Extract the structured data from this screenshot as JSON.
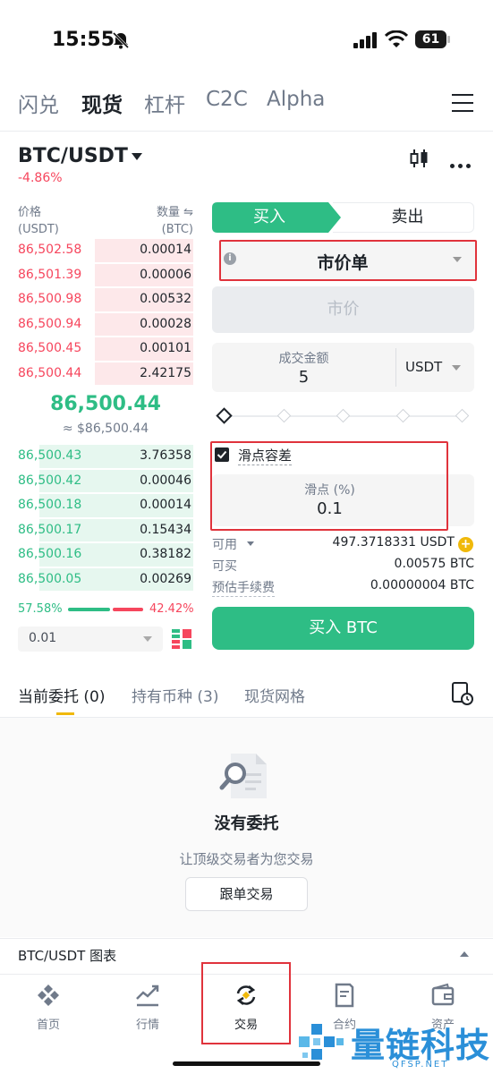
{
  "status_bar": {
    "time": "15:55",
    "battery": "61"
  },
  "top_tabs": [
    "闪兑",
    "现货",
    "杠杆",
    "C2C",
    "Alpha"
  ],
  "active_top_tab": "现货",
  "pair": {
    "symbol": "BTC/USDT",
    "change": "-4.86%"
  },
  "order_book": {
    "price_header": "价格",
    "price_unit": "(USDT)",
    "qty_header": "数量 ⇋",
    "qty_unit": "(BTC)",
    "asks": [
      {
        "price": "86,502.58",
        "qty": "0.00014",
        "depth": 0.56
      },
      {
        "price": "86,501.39",
        "qty": "0.00006",
        "depth": 0.56
      },
      {
        "price": "86,500.98",
        "qty": "0.00532",
        "depth": 0.56
      },
      {
        "price": "86,500.94",
        "qty": "0.00028",
        "depth": 0.56
      },
      {
        "price": "86,500.45",
        "qty": "0.00101",
        "depth": 0.56
      },
      {
        "price": "86,500.44",
        "qty": "2.42175",
        "depth": 0.56
      }
    ],
    "last_price": "86,500.44",
    "last_price_usd": "≈ $86,500.44",
    "bids": [
      {
        "price": "86,500.43",
        "qty": "3.76358",
        "depth": 0.88
      },
      {
        "price": "86,500.42",
        "qty": "0.00046",
        "depth": 0.88
      },
      {
        "price": "86,500.18",
        "qty": "0.00014",
        "depth": 0.88
      },
      {
        "price": "86,500.17",
        "qty": "0.15434",
        "depth": 0.88
      },
      {
        "price": "86,500.16",
        "qty": "0.38182",
        "depth": 0.88
      },
      {
        "price": "86,500.05",
        "qty": "0.00269",
        "depth": 0.88
      }
    ],
    "buy_ratio": "57.58%",
    "sell_ratio": "42.42%",
    "buy_ratio_value": 57.58,
    "step": "0.01"
  },
  "order_form": {
    "buy_label": "买入",
    "sell_label": "卖出",
    "order_type": "市价单",
    "price_placeholder": "市价",
    "amount_label": "成交金额",
    "amount_value": "5",
    "amount_unit": "USDT",
    "slippage_label": "滑点容差",
    "slippage_box_label": "滑点 (%)",
    "slippage_value": "0.1",
    "available_label": "可用",
    "available_value": "497.3718331 USDT",
    "can_buy_label": "可买",
    "can_buy_value": "0.00575 BTC",
    "fee_label": "预估手续费",
    "fee_value": "0.00000004 BTC",
    "submit_label": "买入 BTC"
  },
  "orders_tabs": {
    "open": "当前委托 (0)",
    "holdings": "持有币种 (3)",
    "grid": "现货网格"
  },
  "empty_state": {
    "title": "没有委托",
    "subtitle": "让顶级交易者为您交易",
    "button": "跟单交易"
  },
  "chart_section": {
    "title": "BTC/USDT 图表"
  },
  "bottom_nav": [
    {
      "label": "首页",
      "icon": "home-icon"
    },
    {
      "label": "行情",
      "icon": "markets-icon"
    },
    {
      "label": "交易",
      "icon": "trade-icon"
    },
    {
      "label": "合约",
      "icon": "futures-icon"
    },
    {
      "label": "资产",
      "icon": "wallet-icon"
    }
  ],
  "watermark": {
    "text": "量链科技",
    "sub": "QFSP.NET"
  },
  "colors": {
    "buy": "#2ebd85",
    "sell": "#f6465d",
    "accent": "#f0b90b",
    "highlight": "#e0333c"
  }
}
